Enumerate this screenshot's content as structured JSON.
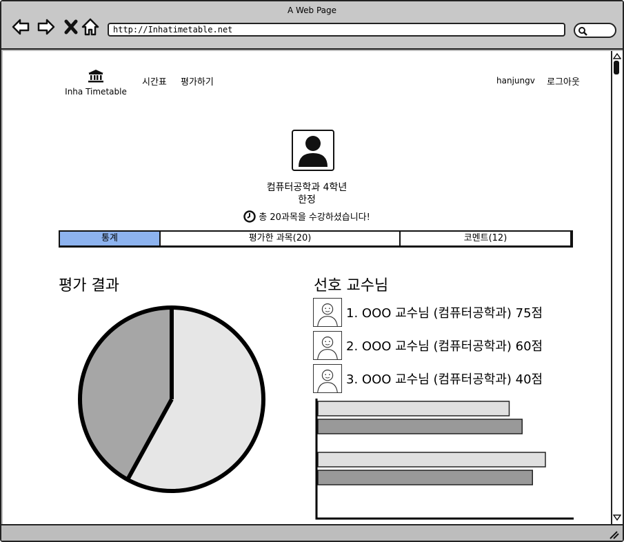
{
  "browser": {
    "title": "A Web Page",
    "url": "http://Inhatimetable.net"
  },
  "header": {
    "logo_text": "Inha Timetable",
    "nav": [
      "시간표",
      "평가하기"
    ],
    "username": "hanjungv",
    "logout": "로그아웃"
  },
  "profile": {
    "department_year": "컴퓨터공학과 4학년",
    "name": "한정",
    "summary": "총 20과목을 수강하셨습니다!"
  },
  "tabs": [
    {
      "label": "통계",
      "active": true
    },
    {
      "label": "평가한 과목(20)",
      "active": false
    },
    {
      "label": "코멘트(12)",
      "active": false
    }
  ],
  "evaluation": {
    "title": "평가 결과"
  },
  "favorites": {
    "title": "선호 교수님",
    "items": [
      "1. OOO 교수님 (컴퓨터공학과) 75점",
      "2. OOO 교수님 (컴퓨터공학과) 60점",
      "3. OOO 교수님 (컴퓨터공학과) 40점"
    ]
  },
  "colors": {
    "active_tab": "#8db3ef",
    "pie_light": "#e6e6e6",
    "pie_dark": "#a6a6a6",
    "bar_light": "#e0e0e0",
    "bar_dark": "#999999"
  },
  "chart_data": [
    {
      "type": "pie",
      "slices": [
        {
          "value": 58,
          "color": "#e6e6e6"
        },
        {
          "value": 42,
          "color": "#a6a6a6"
        }
      ]
    },
    {
      "type": "bar",
      "orientation": "horizontal",
      "xlim": [
        0,
        100
      ],
      "groups": [
        {
          "values": [
            74,
            79
          ]
        },
        {
          "values": [
            88,
            83
          ]
        }
      ]
    }
  ]
}
